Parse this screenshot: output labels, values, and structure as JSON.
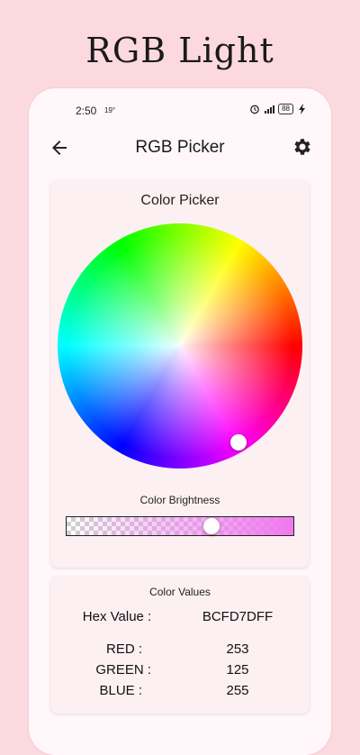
{
  "promo": {
    "title": "RGB Light"
  },
  "status_bar": {
    "time": "2:50",
    "temperature": "19°",
    "battery": "88"
  },
  "app_bar": {
    "title": "RGB Picker",
    "back_icon": "arrow-back-icon",
    "settings_icon": "gear-icon"
  },
  "color_picker": {
    "title": "Color Picker",
    "brightness_label": "Color Brightness",
    "brightness_level": 0.65
  },
  "color_values": {
    "title": "Color Values",
    "hex_label": "Hex Value :",
    "hex_value": "BCFD7DFF",
    "red_label": "RED :",
    "red_value": "253",
    "green_label": "GREEN :",
    "green_value": "125",
    "blue_label": "BLUE :",
    "blue_value": "255"
  },
  "colors": {
    "background": "#fcd9df",
    "card": "#fdf0f2",
    "slider_tint": "#f078f0"
  }
}
